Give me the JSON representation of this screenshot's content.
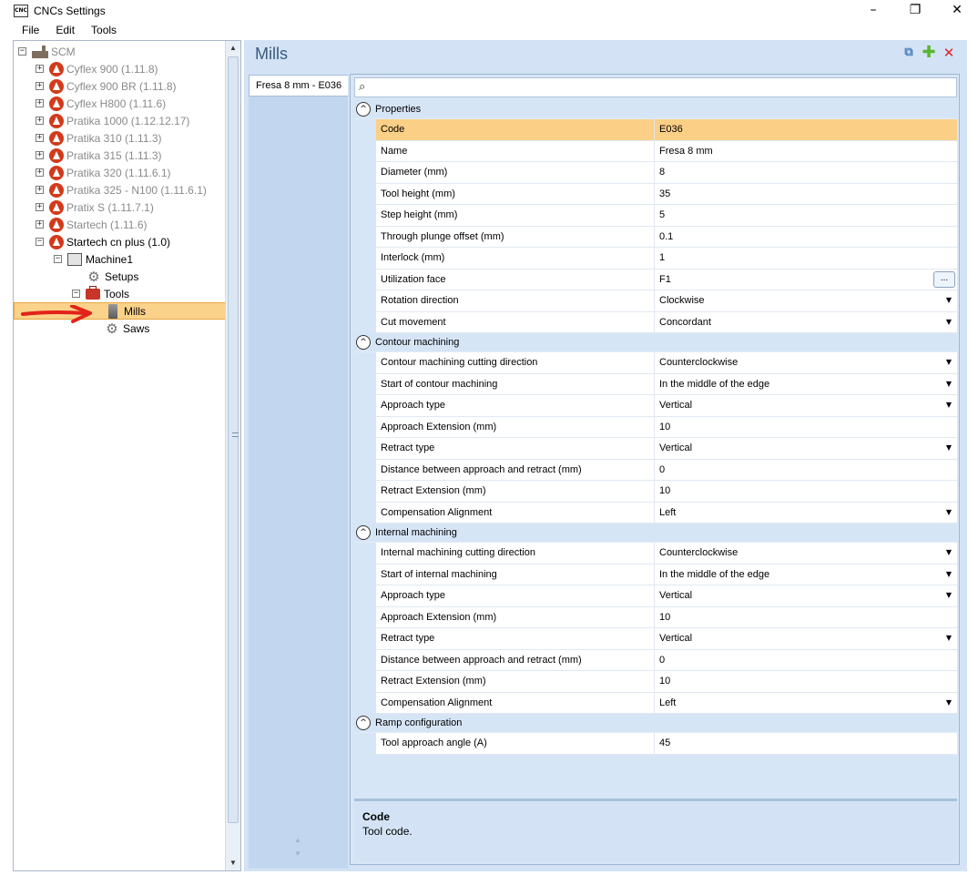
{
  "window": {
    "icon_text": "CNC",
    "title": "CNCs Settings",
    "minimize": "–",
    "restore": "❐",
    "close": "✕"
  },
  "menu": [
    "File",
    "Edit",
    "Tools"
  ],
  "tree": {
    "root": "SCM",
    "machines": [
      {
        "label": "Cyflex 900 (1.11.8)"
      },
      {
        "label": "Cyflex 900 BR (1.11.8)"
      },
      {
        "label": "Cyflex H800 (1.11.6)"
      },
      {
        "label": "Pratika 1000 (1.12.12.17)"
      },
      {
        "label": "Pratika 310 (1.11.3)"
      },
      {
        "label": "Pratika 315 (1.11.3)"
      },
      {
        "label": "Pratika 320 (1.11.6.1)"
      },
      {
        "label": "Pratika 325 - N100 (1.11.6.1)"
      },
      {
        "label": "Pratix S (1.11.7.1)"
      },
      {
        "label": "Startech (1.11.6)"
      },
      {
        "label": "Startech cn plus (1.0)"
      }
    ],
    "machine1": "Machine1",
    "setups": "Setups",
    "tools": "Tools",
    "mills": "Mills",
    "saws": "Saws",
    "expand_glyph": "+",
    "collapse_glyph": "−"
  },
  "main": {
    "title": "Mills",
    "list_items": [
      "Fresa 8 mm - E036"
    ],
    "search_icon": "⌕",
    "groups": [
      {
        "label": "Properties",
        "rows": [
          {
            "name": "Code",
            "value": "E036",
            "highlight": true
          },
          {
            "name": "Name",
            "value": "Fresa 8 mm"
          },
          {
            "name": "Diameter (mm)",
            "value": "8"
          },
          {
            "name": "Tool height (mm)",
            "value": "35"
          },
          {
            "name": "Step height (mm)",
            "value": "5"
          },
          {
            "name": "Through plunge offset (mm)",
            "value": "0.1"
          },
          {
            "name": "Interlock (mm)",
            "value": "1"
          },
          {
            "name": "Utilization face",
            "value": "F1",
            "ellipsis": true
          },
          {
            "name": "Rotation direction",
            "value": "Clockwise",
            "dropdown": true
          },
          {
            "name": "Cut movement",
            "value": "Concordant",
            "dropdown": true
          }
        ]
      },
      {
        "label": "Contour machining",
        "rows": [
          {
            "name": "Contour machining cutting direction",
            "value": "Counterclockwise",
            "dropdown": true
          },
          {
            "name": "Start of contour machining",
            "value": "In the middle of the edge",
            "dropdown": true
          },
          {
            "name": "Approach type",
            "value": "Vertical",
            "dropdown": true
          },
          {
            "name": "Approach Extension (mm)",
            "value": "10"
          },
          {
            "name": "Retract type",
            "value": "Vertical",
            "dropdown": true
          },
          {
            "name": "Distance between approach and retract (mm)",
            "value": "0"
          },
          {
            "name": "Retract Extension (mm)",
            "value": "10"
          },
          {
            "name": "Compensation Alignment",
            "value": "Left",
            "dropdown": true
          }
        ]
      },
      {
        "label": "Internal machining",
        "rows": [
          {
            "name": "Internal machining cutting direction",
            "value": "Counterclockwise",
            "dropdown": true
          },
          {
            "name": "Start of internal machining",
            "value": "In the middle of the edge",
            "dropdown": true
          },
          {
            "name": "Approach type",
            "value": "Vertical",
            "dropdown": true
          },
          {
            "name": "Approach Extension (mm)",
            "value": "10"
          },
          {
            "name": "Retract type",
            "value": "Vertical",
            "dropdown": true
          },
          {
            "name": "Distance between approach and retract (mm)",
            "value": "0"
          },
          {
            "name": "Retract Extension (mm)",
            "value": "10"
          },
          {
            "name": "Compensation Alignment",
            "value": "Left",
            "dropdown": true
          }
        ]
      },
      {
        "label": "Ramp configuration",
        "rows": [
          {
            "name": "Tool approach angle (A)",
            "value": "45"
          }
        ]
      }
    ],
    "description": {
      "title": "Code",
      "text": "Tool code."
    },
    "ellipsis_label": "...",
    "dropdown_glyph": "▼",
    "collapse_glyph": "^"
  },
  "colors": {
    "selection": "#fbd28a",
    "panel_bg": "#d3e3f5",
    "machine_icon": "#d23a1c",
    "annotation_arrow": "#e2231a"
  }
}
